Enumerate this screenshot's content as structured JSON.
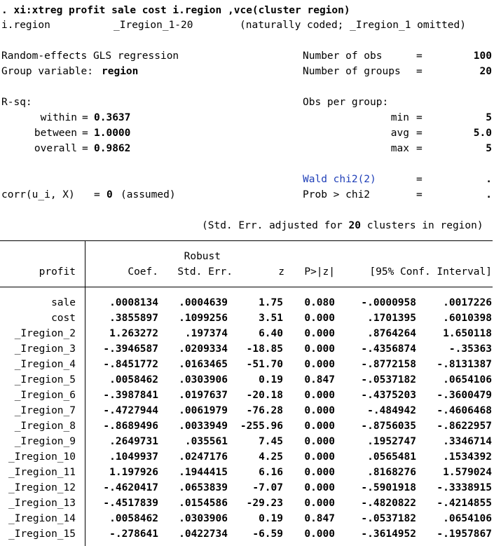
{
  "command": ". xi:xtreg profit sale cost i.region ,vce(cluster region)",
  "xi_note": {
    "var": "i.region",
    "stub": "_Iregion_1-20",
    "note": "(naturally coded; _Iregion_1 omitted)"
  },
  "header": {
    "model": "Random-effects GLS regression",
    "group_var_label": "Group variable:",
    "group_var": "region",
    "nobs_label": "Number of obs",
    "nobs": "100",
    "ngroups_label": "Number of groups",
    "ngroups": "20",
    "rsq_label": "R-sq:",
    "within_label": "within",
    "within": "0.3637",
    "between_label": "between",
    "between": "1.0000",
    "overall_label": "overall",
    "overall": "0.9862",
    "obs_per_group_label": "Obs per group:",
    "min_label": "min",
    "min": "5",
    "avg_label": "avg",
    "avg": "5.0",
    "max_label": "max",
    "max": "5",
    "wald_label": "Wald chi2(2)",
    "wald": ".",
    "prob_label": "Prob > chi2",
    "prob": ".",
    "corr_label": "corr(u_i, X)",
    "corr_value": "0",
    "corr_note": "(assumed)",
    "eq": "=",
    "se_note_pre": "(Std. Err. adjusted for",
    "se_note_n": "20",
    "se_note_post": "clusters in region)"
  },
  "table": {
    "depvar": "profit",
    "robust_label": "Robust",
    "col_coef": "Coef.",
    "col_se": "Std. Err.",
    "col_z": "z",
    "col_p": "P>|z|",
    "col_ci": "[95% Conf. Interval]",
    "rows": [
      {
        "name": "sale",
        "coef": ".0008134",
        "se": ".0004639",
        "z": "1.75",
        "p": "0.080",
        "lo": "-.0000958",
        "hi": ".0017226"
      },
      {
        "name": "cost",
        "coef": ".3855897",
        "se": ".1099256",
        "z": "3.51",
        "p": "0.000",
        "lo": ".1701395",
        "hi": ".6010398"
      },
      {
        "name": "_Iregion_2",
        "coef": "1.263272",
        "se": ".197374",
        "z": "6.40",
        "p": "0.000",
        "lo": ".8764264",
        "hi": "1.650118"
      },
      {
        "name": "_Iregion_3",
        "coef": "-.3946587",
        "se": ".0209334",
        "z": "-18.85",
        "p": "0.000",
        "lo": "-.4356874",
        "hi": "-.35363"
      },
      {
        "name": "_Iregion_4",
        "coef": "-.8451772",
        "se": ".0163465",
        "z": "-51.70",
        "p": "0.000",
        "lo": "-.8772158",
        "hi": "-.8131387"
      },
      {
        "name": "_Iregion_5",
        "coef": ".0058462",
        "se": ".0303906",
        "z": "0.19",
        "p": "0.847",
        "lo": "-.0537182",
        "hi": ".0654106"
      },
      {
        "name": "_Iregion_6",
        "coef": "-.3987841",
        "se": ".0197637",
        "z": "-20.18",
        "p": "0.000",
        "lo": "-.4375203",
        "hi": "-.3600479"
      },
      {
        "name": "_Iregion_7",
        "coef": "-.4727944",
        "se": ".0061979",
        "z": "-76.28",
        "p": "0.000",
        "lo": "-.484942",
        "hi": "-.4606468"
      },
      {
        "name": "_Iregion_8",
        "coef": "-.8689496",
        "se": ".0033949",
        "z": "-255.96",
        "p": "0.000",
        "lo": "-.8756035",
        "hi": "-.8622957"
      },
      {
        "name": "_Iregion_9",
        "coef": ".2649731",
        "se": ".035561",
        "z": "7.45",
        "p": "0.000",
        "lo": ".1952747",
        "hi": ".3346714"
      },
      {
        "name": "_Iregion_10",
        "coef": ".1049937",
        "se": ".0247176",
        "z": "4.25",
        "p": "0.000",
        "lo": ".0565481",
        "hi": ".1534392"
      },
      {
        "name": "_Iregion_11",
        "coef": "1.197926",
        "se": ".1944415",
        "z": "6.16",
        "p": "0.000",
        "lo": ".8168276",
        "hi": "1.579024"
      },
      {
        "name": "_Iregion_12",
        "coef": "-.4620417",
        "se": ".0653839",
        "z": "-7.07",
        "p": "0.000",
        "lo": "-.5901918",
        "hi": "-.3338915"
      },
      {
        "name": "_Iregion_13",
        "coef": "-.4517839",
        "se": ".0154586",
        "z": "-29.23",
        "p": "0.000",
        "lo": "-.4820822",
        "hi": "-.4214855"
      },
      {
        "name": "_Iregion_14",
        "coef": ".0058462",
        "se": ".0303906",
        "z": "0.19",
        "p": "0.847",
        "lo": "-.0537182",
        "hi": ".0654106"
      },
      {
        "name": "_Iregion_15",
        "coef": "-.278641",
        "se": ".0422734",
        "z": "-6.59",
        "p": "0.000",
        "lo": "-.3614952",
        "hi": "-.1957867"
      }
    ]
  }
}
